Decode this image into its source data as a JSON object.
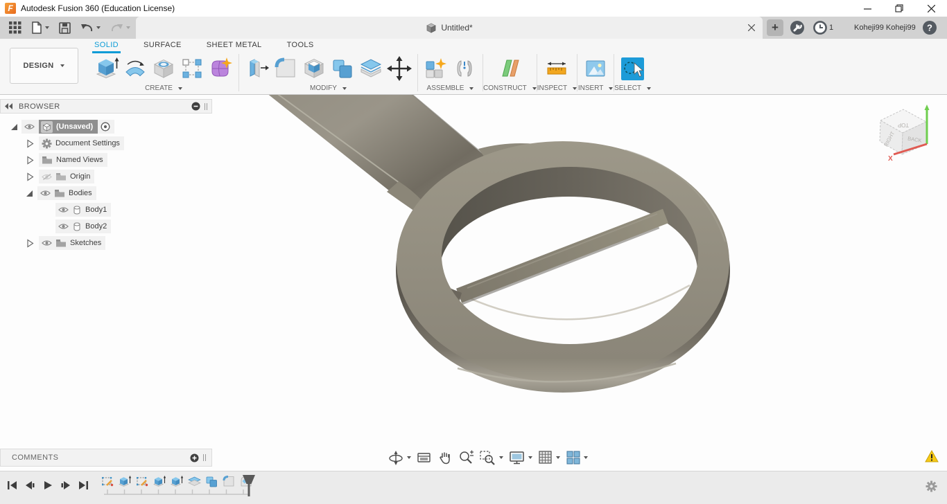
{
  "window": {
    "title": "Autodesk Fusion 360 (Education License)"
  },
  "tabbar": {
    "document_tab": {
      "title": "Untitled*"
    },
    "job_count": "1",
    "user_name": "Koheji99 Koheji99"
  },
  "ribbon": {
    "design_menu": "DESIGN",
    "tabs": [
      {
        "label": "SOLID",
        "active": true
      },
      {
        "label": "SURFACE",
        "active": false
      },
      {
        "label": "SHEET METAL",
        "active": false
      },
      {
        "label": "TOOLS",
        "active": false
      }
    ],
    "groups": [
      {
        "label": "CREATE"
      },
      {
        "label": "MODIFY"
      },
      {
        "label": "ASSEMBLE"
      },
      {
        "label": "CONSTRUCT"
      },
      {
        "label": "INSPECT"
      },
      {
        "label": "INSERT"
      },
      {
        "label": "SELECT"
      }
    ]
  },
  "browser": {
    "header": "BROWSER",
    "nodes": [
      {
        "label": "(Unsaved)",
        "selected": true,
        "icon": "document-cube",
        "eye": "visible",
        "expander": "open"
      },
      {
        "label": "Document Settings",
        "icon": "gear",
        "expander": "closed"
      },
      {
        "label": "Named Views",
        "icon": "folder",
        "expander": "closed"
      },
      {
        "label": "Origin",
        "icon": "folder",
        "eye": "hidden",
        "expander": "closed"
      },
      {
        "label": "Bodies",
        "icon": "folder",
        "eye": "visible",
        "expander": "open"
      },
      {
        "label": "Body1",
        "icon": "body",
        "eye": "visible"
      },
      {
        "label": "Body2",
        "icon": "body",
        "eye": "visible"
      },
      {
        "label": "Sketches",
        "icon": "folder",
        "eye": "visible",
        "expander": "closed"
      }
    ]
  },
  "viewcube": {
    "top": "TOP",
    "back": "BACK",
    "right": "RIGHT",
    "axis_x": "X"
  },
  "comments": {
    "header": "COMMENTS"
  },
  "timeline": {
    "features": [
      "sketch",
      "extrude",
      "sketch",
      "extrude",
      "extrude",
      "split-body",
      "combine",
      "fillet",
      "fillet"
    ]
  },
  "colors": {
    "accent_blue": "#0a9bd6",
    "select_tile_blue": "#1d9bd8",
    "warning_yellow": "#f6c915",
    "model_taupe": "#8f8a7d"
  }
}
